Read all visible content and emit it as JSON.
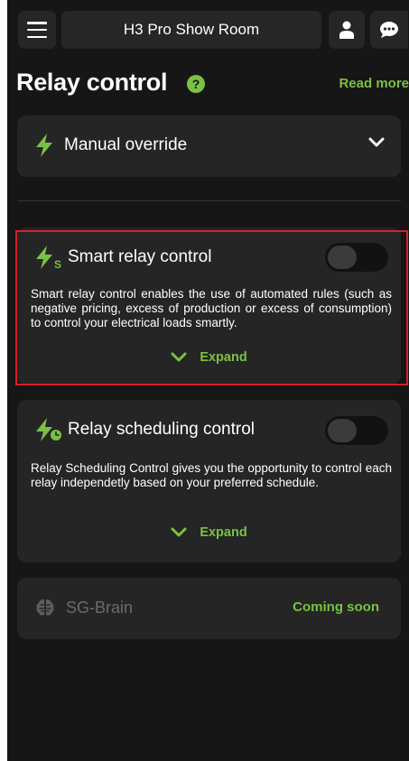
{
  "header": {
    "title": "H3 Pro Show Room"
  },
  "page": {
    "title": "Relay control",
    "read_more": "Read more"
  },
  "manual_override": {
    "label": "Manual override"
  },
  "smart_relay": {
    "label": "Smart relay control",
    "description": "Smart relay control enables the use of automated rules (such as negative pricing, excess of production or excess of consumption) to control your electrical loads smartly.",
    "expand": "Expand",
    "enabled": false,
    "icon_subscript": "S"
  },
  "relay_scheduling": {
    "label": "Relay scheduling control",
    "description": "Relay Scheduling Control gives you the opportunity to control each relay independetly based on your preferred schedule.",
    "expand": "Expand",
    "enabled": false
  },
  "sg_brain": {
    "label": "SG-Brain",
    "status": "Coming soon"
  },
  "colors": {
    "accent": "#7ac143",
    "background": "#161616",
    "card": "#252525",
    "highlight": "#d6202c"
  },
  "icons": {
    "menu": "hamburger-icon",
    "user": "user-icon",
    "chat": "chat-icon",
    "help": "help-icon",
    "bolt": "lightning-icon",
    "brain": "brain-icon"
  }
}
